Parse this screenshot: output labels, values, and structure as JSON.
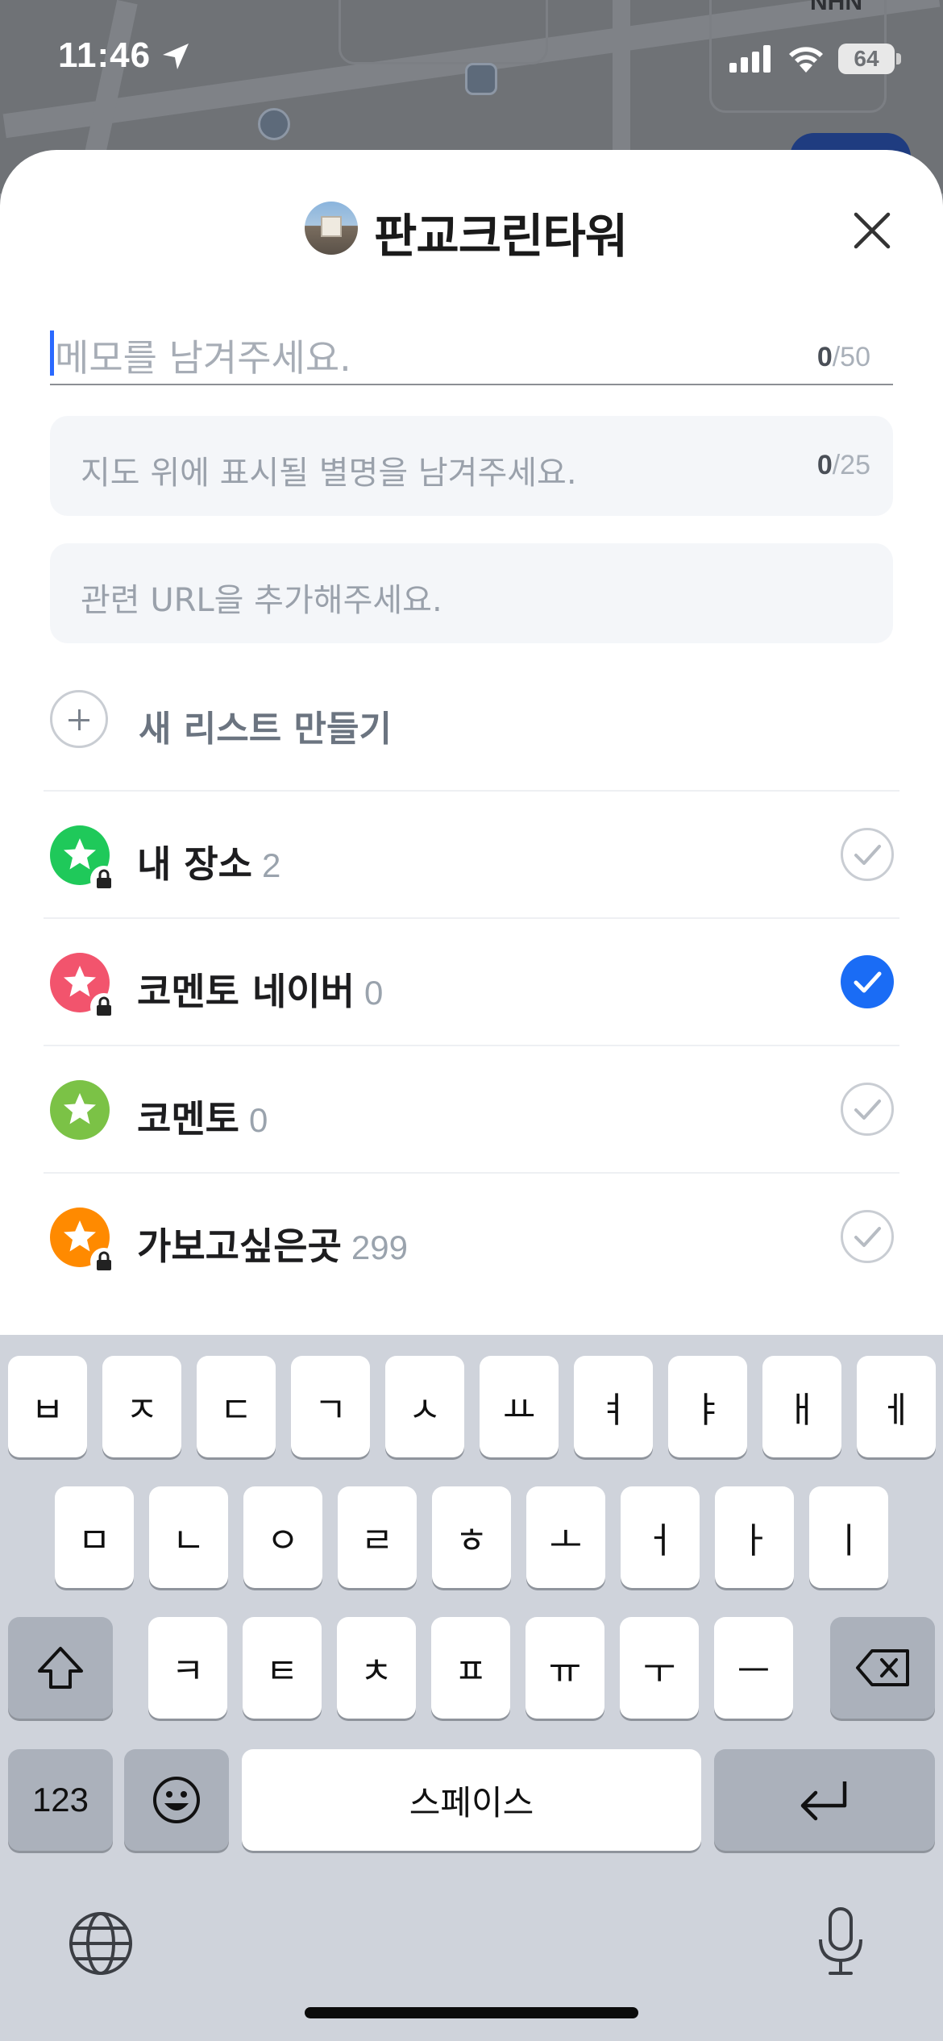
{
  "status_bar": {
    "time": "11:46",
    "battery": "64",
    "location_icon": "location-arrow-icon",
    "signal_icon": "cellular-signal-icon",
    "wifi_icon": "wifi-icon"
  },
  "map": {
    "label": "NHN"
  },
  "place": {
    "title": "판교크린타워",
    "thumbnail_icon": "place-photo"
  },
  "memo": {
    "placeholder": "메모를 남겨주세요.",
    "count_current": "0",
    "count_max": "/50"
  },
  "alias": {
    "placeholder": "지도 위에 표시될 별명을 남겨주세요.",
    "count_current": "0",
    "count_max": "/25"
  },
  "url": {
    "placeholder": "관련 URL을 추가해주세요."
  },
  "new_list": {
    "label": "새 리스트 만들기"
  },
  "lists": [
    {
      "name": "내 장소",
      "count": "2",
      "color": "#1fc95a",
      "locked": true,
      "checked": false
    },
    {
      "name": "코멘토 네이버",
      "count": "0",
      "color": "#f2546d",
      "locked": true,
      "checked": true
    },
    {
      "name": "코멘토",
      "count": "0",
      "color": "#7bc246",
      "locked": false,
      "checked": false
    },
    {
      "name": "가보고싶은곳",
      "count": "299",
      "color": "#ff8a00",
      "locked": true,
      "checked": false
    }
  ],
  "keyboard": {
    "row1": [
      "ㅂ",
      "ㅈ",
      "ㄷ",
      "ㄱ",
      "ㅅ",
      "ㅛ",
      "ㅕ",
      "ㅑ",
      "ㅐ",
      "ㅔ"
    ],
    "row2": [
      "ㅁ",
      "ㄴ",
      "ㅇ",
      "ㄹ",
      "ㅎ",
      "ㅗ",
      "ㅓ",
      "ㅏ",
      "ㅣ"
    ],
    "row3": [
      "ㅋ",
      "ㅌ",
      "ㅊ",
      "ㅍ",
      "ㅠ",
      "ㅜ",
      "ㅡ"
    ],
    "numbers_label": "123",
    "space_label": "스페이스"
  },
  "colors": {
    "accent": "#1a6cf5",
    "keyboard_bg": "#cfd3db"
  }
}
